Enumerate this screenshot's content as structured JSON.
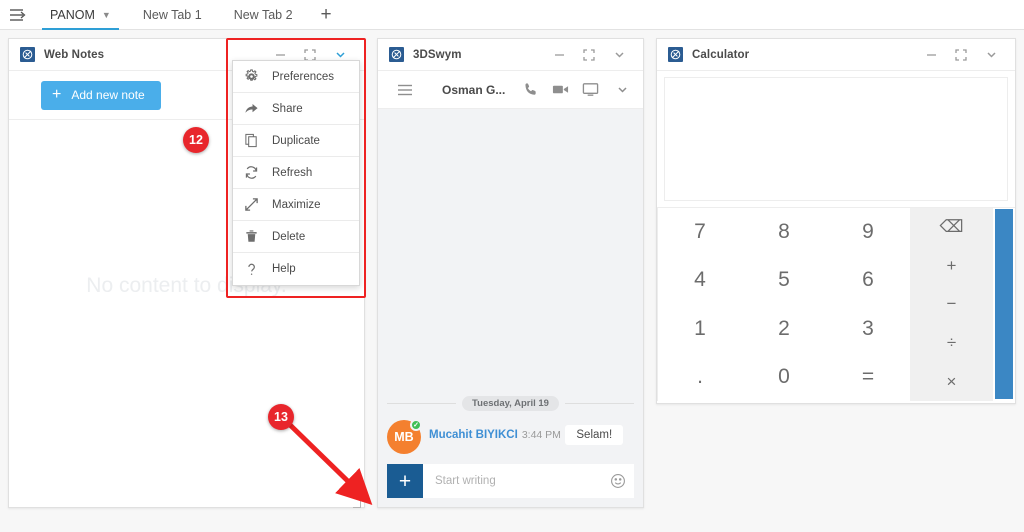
{
  "tabbar": {
    "menu_icon": "hamburger-menu-icon",
    "tabs": [
      {
        "label": "PANOM",
        "active": true,
        "chevron": "⌄"
      },
      {
        "label": "New Tab 1",
        "active": false
      },
      {
        "label": "New Tab 2",
        "active": false
      }
    ],
    "add_tab": "+"
  },
  "web_notes": {
    "title": "Web Notes",
    "add_note_label": "Add new note",
    "add_note_plus": "+",
    "empty_text": "No content to display.",
    "controls": {
      "minimize": "—",
      "restore": "restore-icon",
      "chevron": "⌄"
    }
  },
  "dropdown": {
    "items": [
      {
        "label": "Preferences",
        "icon": "gear-icon"
      },
      {
        "label": "Share",
        "icon": "share-arrow-icon"
      },
      {
        "label": "Duplicate",
        "icon": "copy-icon"
      },
      {
        "label": "Refresh",
        "icon": "refresh-icon"
      },
      {
        "label": "Maximize",
        "icon": "maximize-arrow-icon"
      },
      {
        "label": "Delete",
        "icon": "trash-icon"
      },
      {
        "label": "Help",
        "icon": "question-mark-icon"
      }
    ]
  },
  "swym": {
    "title": "3DSwym",
    "user": "Osman G...",
    "toolbar_icons": [
      "hamburger-icon",
      "phone-icon",
      "video-camera-icon",
      "screen-share-icon",
      "chevron-down-icon"
    ],
    "date_divider": "Tuesday, April 19",
    "message": {
      "avatar_initials": "MB",
      "author": "Mucahit BIYIKCI",
      "time": "3:44 PM",
      "text": "Selam!"
    },
    "composer": {
      "add": "+",
      "placeholder": "Start writing",
      "emoji": "☺"
    }
  },
  "calculator": {
    "title": "Calculator",
    "display_value": "",
    "keys": [
      "7",
      "8",
      "9",
      "4",
      "5",
      "6",
      "1",
      "2",
      "3",
      ".",
      "0",
      "="
    ],
    "ops": [
      "⌫",
      "+",
      "−",
      "÷",
      "×"
    ]
  },
  "annotations": {
    "badge_12": "12",
    "badge_13": "13"
  },
  "colors": {
    "accent_blue": "#2e9fd6",
    "button_blue": "#4aaeea",
    "scrollbar_blue": "#3b87c4",
    "avatar_orange": "#f4802f",
    "badge_red": "#e8262c",
    "composer_blue": "#1a5c93"
  }
}
